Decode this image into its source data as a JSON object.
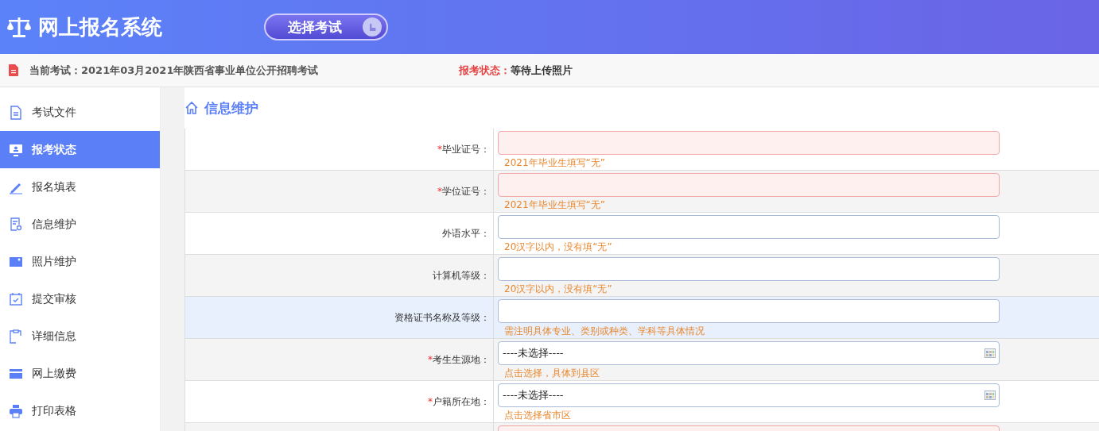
{
  "header": {
    "title": "网上报名系统",
    "select_button": "选择考试"
  },
  "info_bar": {
    "exam_label": "当前考试：",
    "exam_name": "2021年03月2021年陕西省事业单位公开招聘考试",
    "status_label": "报考状态：",
    "status_value": "等待上传照片"
  },
  "sidebar": {
    "items": [
      {
        "label": "考试文件",
        "selected": false
      },
      {
        "label": "报考状态",
        "selected": true
      },
      {
        "label": "报名填表",
        "selected": false
      },
      {
        "label": "信息维护",
        "selected": false
      },
      {
        "label": "照片维护",
        "selected": false
      },
      {
        "label": "提交审核",
        "selected": false
      },
      {
        "label": "详细信息",
        "selected": false
      },
      {
        "label": "网上缴费",
        "selected": false
      },
      {
        "label": "打印表格",
        "selected": false
      }
    ]
  },
  "section_title": "信息维护",
  "form": {
    "rows": [
      {
        "mark": "*",
        "label": "毕业证号：",
        "kind": "text",
        "error": true,
        "highlighted": false,
        "hint": "2021年毕业生填写“无”"
      },
      {
        "mark": "*",
        "label": "学位证号：",
        "kind": "text",
        "error": true,
        "highlighted": false,
        "hint": "2021年毕业生填写“无”"
      },
      {
        "label": "外语水平：",
        "kind": "text",
        "error": false,
        "highlighted": false,
        "hint": "20汉字以内，没有填“无”"
      },
      {
        "label": "计算机等级：",
        "kind": "text",
        "error": false,
        "highlighted": false,
        "hint": "20汉字以内，没有填“无”"
      },
      {
        "label": "资格证书名称及等级：",
        "kind": "text",
        "error": false,
        "highlighted": true,
        "hint": "需注明具体专业、类别或种类、学科等具体情况"
      },
      {
        "mark": "*",
        "label": "考生生源地：",
        "kind": "picker",
        "error": false,
        "highlighted": false,
        "value": "----未选择----",
        "hint": "点击选择，具体到县区"
      },
      {
        "mark": "*",
        "label": "户籍所在地：",
        "kind": "picker",
        "error": false,
        "highlighted": false,
        "value": "----未选择----",
        "hint": "点击选择省市区"
      },
      {
        "kind": "text",
        "error": true,
        "highlighted": false
      }
    ]
  }
}
